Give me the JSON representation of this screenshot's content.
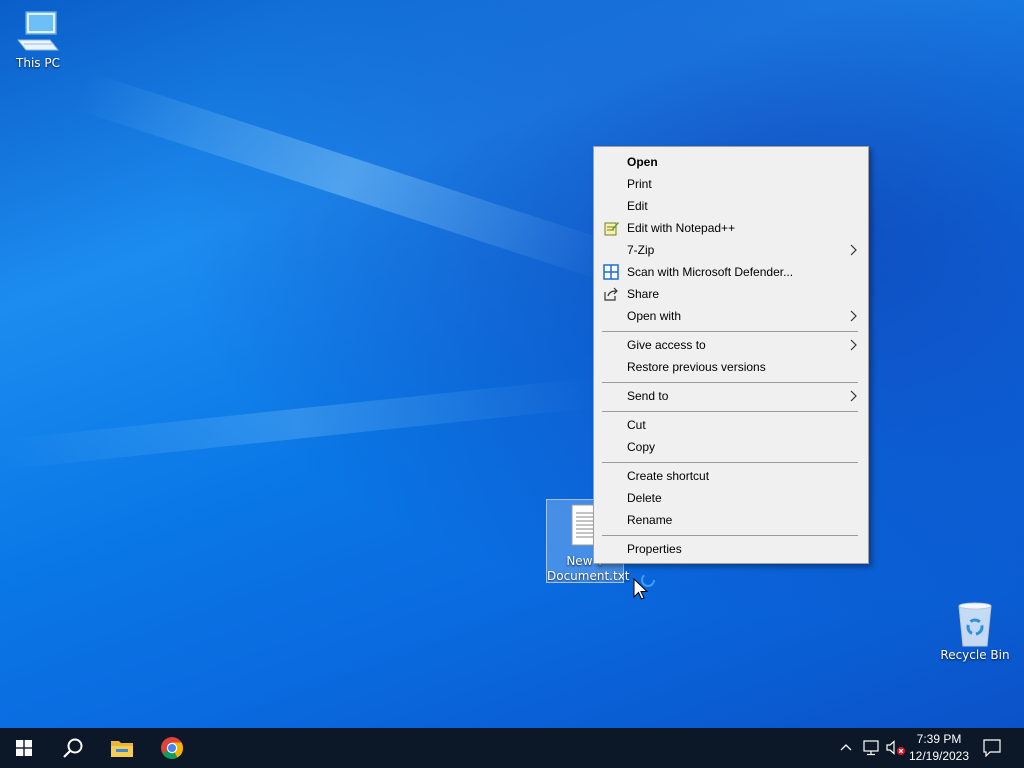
{
  "desktop": {
    "icons": {
      "this_pc": "This PC",
      "new_text_document_line1": "New T",
      "new_text_document_line2": "Document.txt",
      "recycle_bin": "Recycle Bin"
    }
  },
  "context_menu": {
    "items": [
      {
        "label": "Open",
        "bold": true
      },
      {
        "label": "Print"
      },
      {
        "label": "Edit"
      },
      {
        "label": "Edit with Notepad++",
        "icon": "notepadpp-icon"
      },
      {
        "label": "7-Zip",
        "submenu": true
      },
      {
        "label": "Scan with Microsoft Defender...",
        "icon": "defender-icon"
      },
      {
        "label": "Share",
        "icon": "share-icon"
      },
      {
        "label": "Open with",
        "submenu": true
      },
      {
        "label": "Give access to",
        "submenu": true
      },
      {
        "label": "Restore previous versions"
      },
      {
        "label": "Send to",
        "submenu": true
      },
      {
        "label": "Cut"
      },
      {
        "label": "Copy"
      },
      {
        "label": "Create shortcut"
      },
      {
        "label": "Delete"
      },
      {
        "label": "Rename"
      },
      {
        "label": "Properties"
      }
    ]
  },
  "taskbar": {
    "pinned": [
      "start-icon",
      "search-icon",
      "file-explorer-icon",
      "chrome-icon"
    ],
    "tray_icons": [
      "chevron-up-icon",
      "network-icon",
      "volume-muted-icon"
    ],
    "clock": {
      "time": "7:39 PM",
      "date": "12/19/2023"
    },
    "notification_icon": "action-center-icon"
  },
  "colors": {
    "taskbar": "#0c1727",
    "menu_bg": "#f0f0f0",
    "accent": "#0078d7"
  }
}
